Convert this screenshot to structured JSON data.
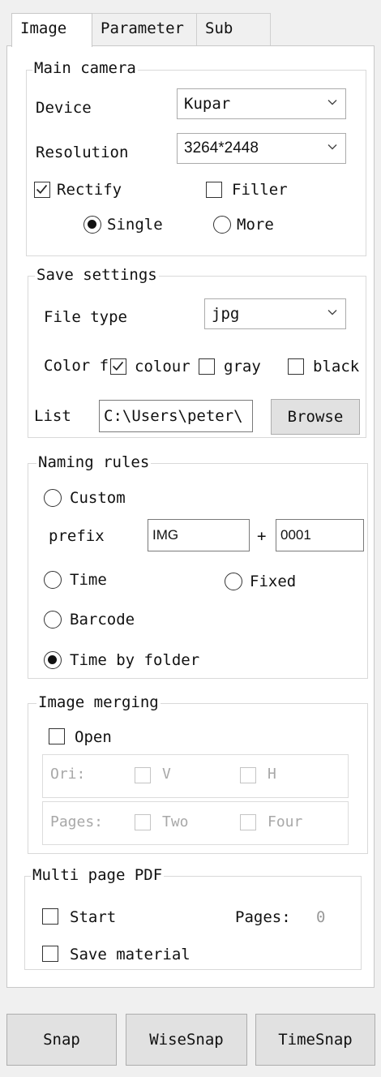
{
  "tabs": [
    {
      "label": "Image"
    },
    {
      "label": "Parameter"
    },
    {
      "label": "Sub"
    }
  ],
  "main_camera": {
    "title": "Main camera",
    "device_label": "Device",
    "device_value": "Kupar",
    "resolution_label": "Resolution",
    "resolution_value": "3264*2448",
    "rectify_label": "Rectify",
    "rectify_checked": true,
    "filler_label": "Filler",
    "filler_checked": false,
    "single_label": "Single",
    "more_label": "More",
    "selected_mode": "Single"
  },
  "save_settings": {
    "title": "Save settings",
    "file_type_label": "File type",
    "file_type_value": "jpg",
    "color_label": "Color f",
    "colour_label": "colour",
    "colour_checked": true,
    "gray_label": "gray",
    "gray_checked": false,
    "black_label": "black",
    "black_checked": false,
    "list_label": "List",
    "list_path": "C:\\Users\\peter\\",
    "browse_label": "Browse"
  },
  "naming_rules": {
    "title": "Naming rules",
    "custom_label": "Custom",
    "prefix_label": "prefix",
    "prefix_value": "IMG",
    "plus": "+",
    "counter_value": "0001",
    "time_label": "Time",
    "fixed_label": "Fixed",
    "barcode_label": "Barcode",
    "time_by_folder_label": "Time by folder",
    "selected": "Time by folder"
  },
  "image_merging": {
    "title": "Image merging",
    "open_label": "Open",
    "open_checked": false,
    "ori_label": "Ori:",
    "v_label": "V",
    "h_label": "H",
    "pages_label": "Pages:",
    "two_label": "Two",
    "four_label": "Four"
  },
  "multi_page_pdf": {
    "title": "Multi page PDF",
    "start_label": "Start",
    "pages_label": "Pages:",
    "pages_value": "0",
    "save_material_label": "Save material"
  },
  "bottom_buttons": {
    "snap": "Snap",
    "wisesnap": "WiseSnap",
    "timesnap": "TimeSnap"
  }
}
